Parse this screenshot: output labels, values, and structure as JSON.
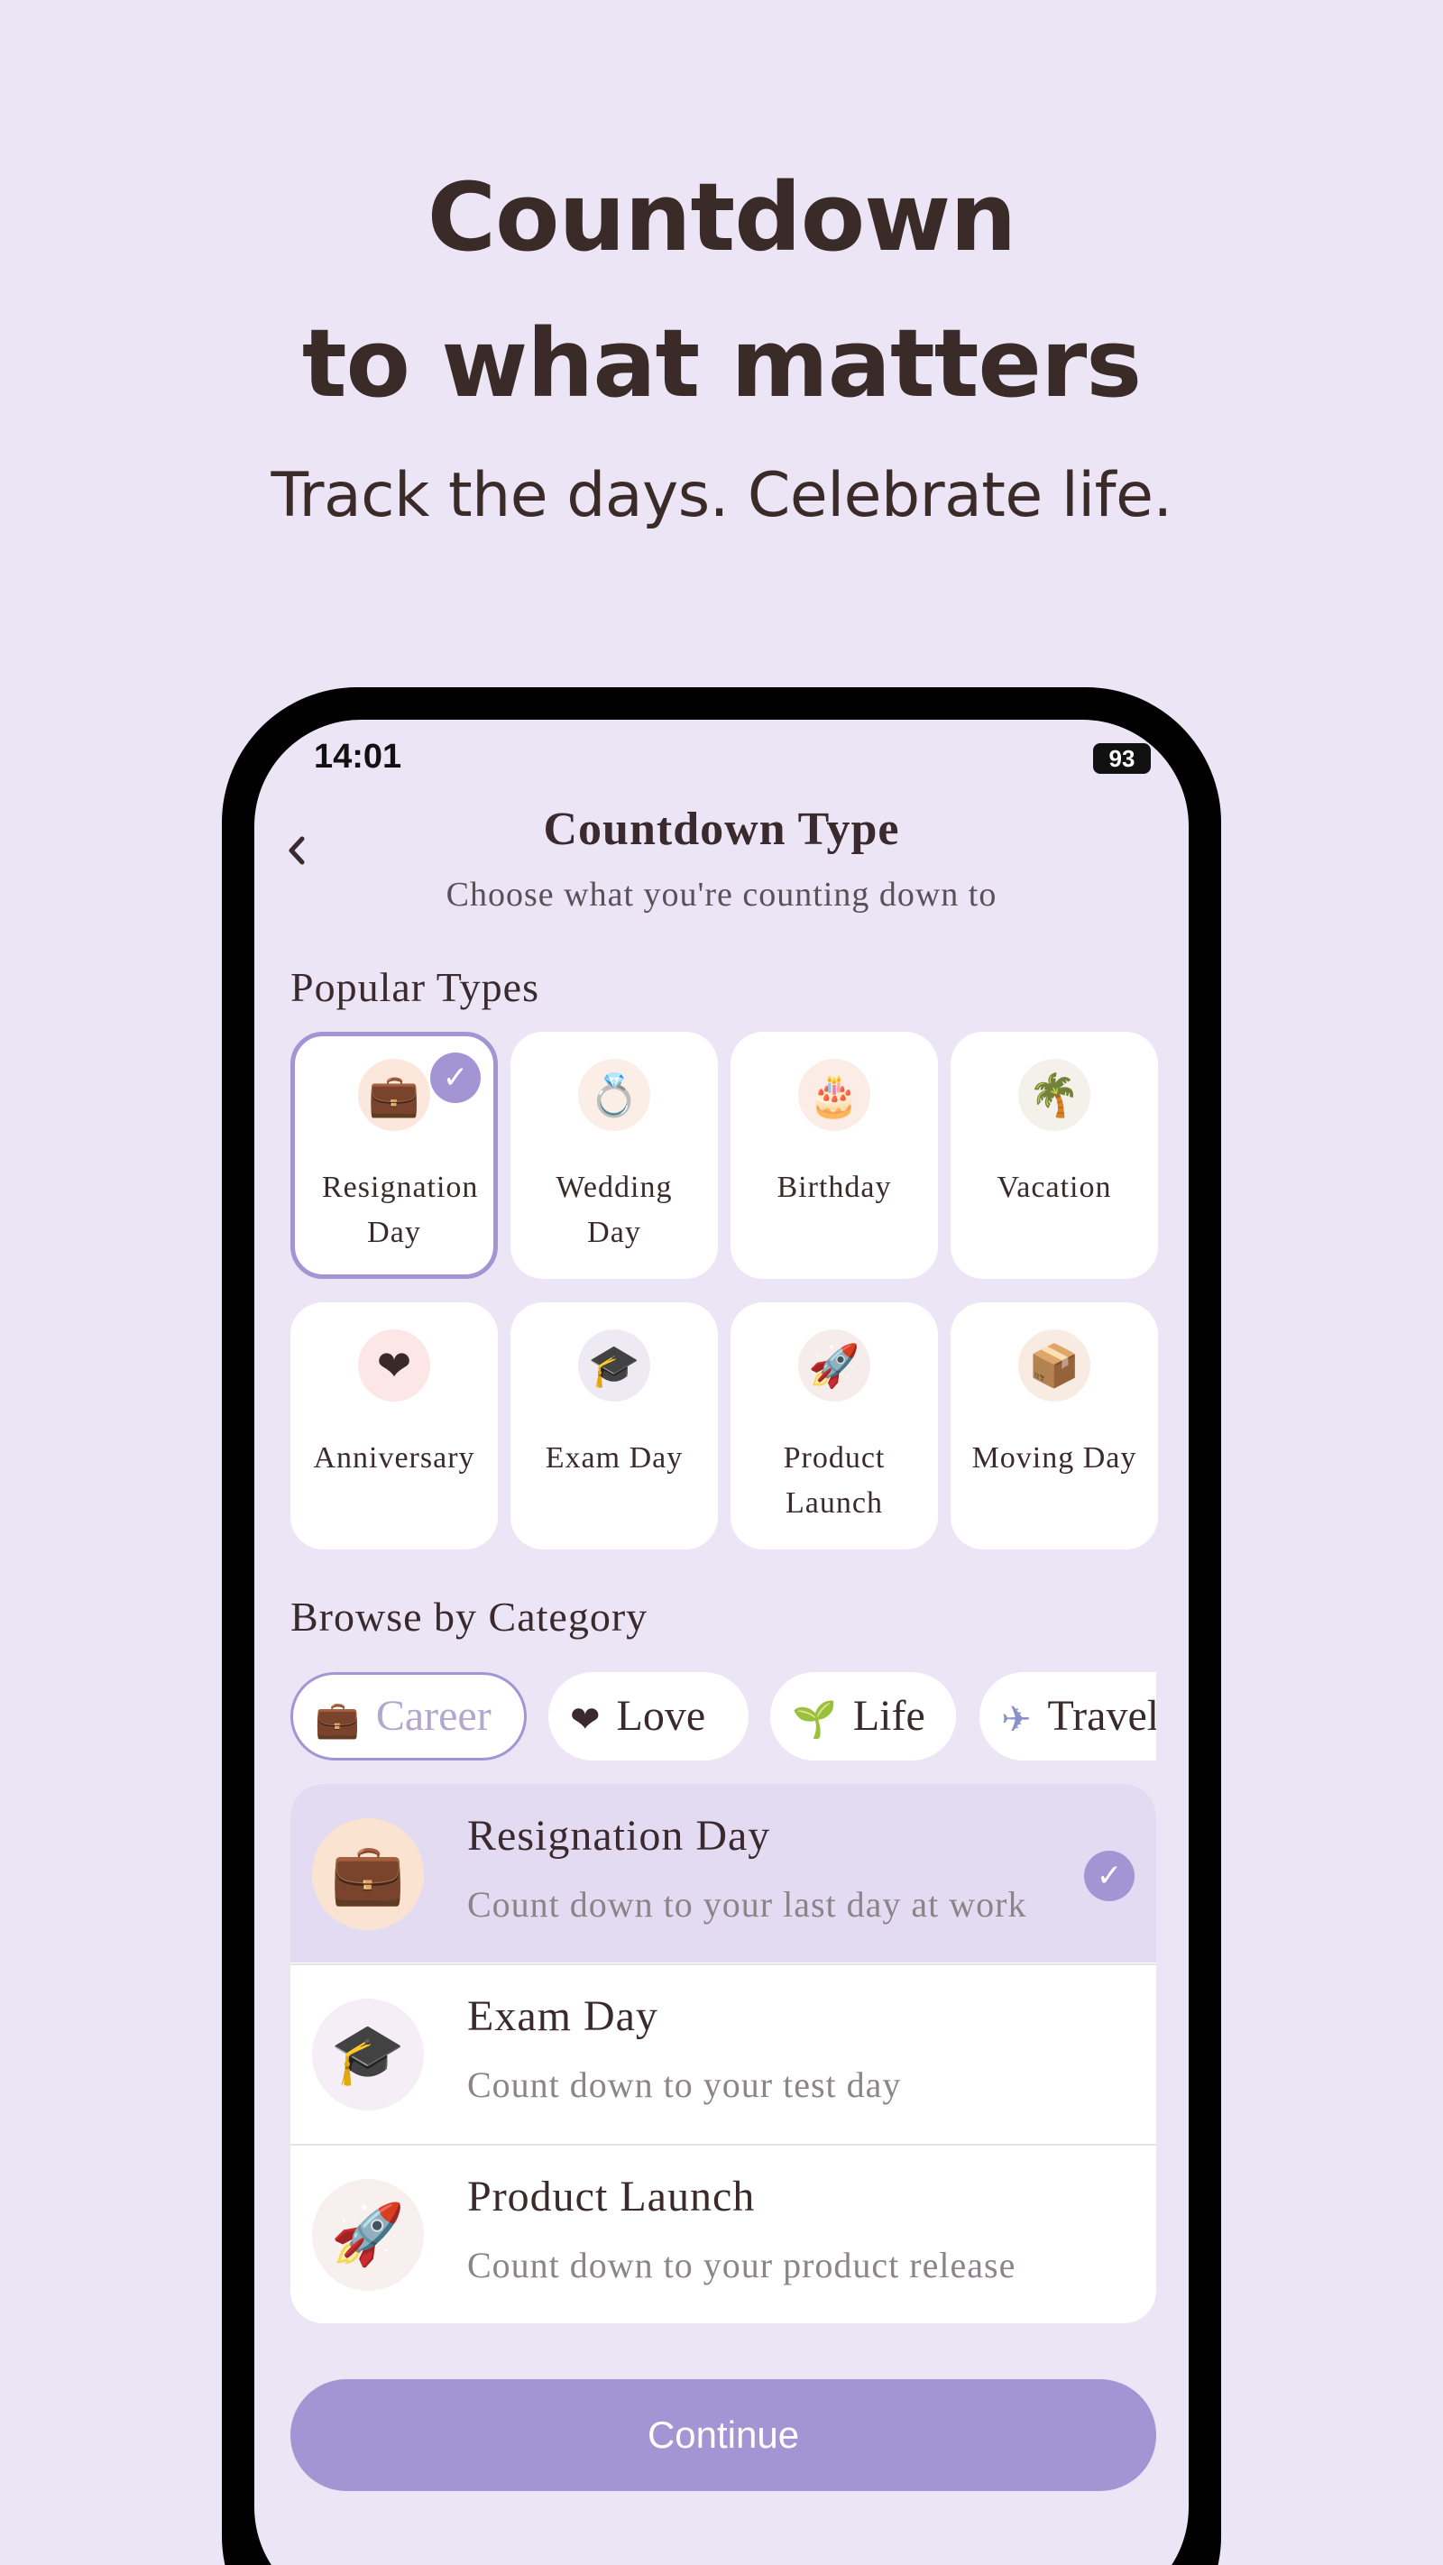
{
  "hero": {
    "title_line1": "Countdown",
    "title_line2": "to what matters",
    "subtitle": "Track the days. Celebrate life."
  },
  "status_bar": {
    "time": "14:01",
    "battery": "93"
  },
  "header": {
    "title": "Countdown Type",
    "subtitle": "Choose what you're counting down to",
    "back_icon": "chevron-left-icon"
  },
  "popular": {
    "label": "Popular Types",
    "items": [
      {
        "label": "Resignation Day",
        "icon": "briefcase-icon",
        "glyph": "💼",
        "selected": true
      },
      {
        "label": "Wedding Day",
        "icon": "rings-icon",
        "glyph": "💍",
        "selected": false
      },
      {
        "label": "Birthday",
        "icon": "cake-icon",
        "glyph": "🎂",
        "selected": false
      },
      {
        "label": "Vacation",
        "icon": "palm-island-icon",
        "glyph": "🌴",
        "selected": false
      },
      {
        "label": "Anniversary",
        "icon": "heart-icon",
        "glyph": "❤",
        "selected": false
      },
      {
        "label": "Exam Day",
        "icon": "graduation-cap-icon",
        "glyph": "🎓",
        "selected": false
      },
      {
        "label": "Product Launch",
        "icon": "rocket-icon",
        "glyph": "🚀",
        "selected": false
      },
      {
        "label": "Moving Day",
        "icon": "box-icon",
        "glyph": "📦",
        "selected": false
      }
    ]
  },
  "category": {
    "label": "Browse by Category",
    "chips": [
      {
        "label": "Career",
        "icon": "briefcase-icon",
        "glyph": "💼",
        "active": true
      },
      {
        "label": "Love",
        "icon": "heart-icon",
        "glyph": "❤",
        "active": false
      },
      {
        "label": "Life",
        "icon": "sprout-icon",
        "glyph": "🌱",
        "active": false
      },
      {
        "label": "Travel",
        "icon": "airplane-icon",
        "glyph": "✈",
        "active": false
      }
    ],
    "list": [
      {
        "title": "Resignation Day",
        "desc": "Count down to your last day at work",
        "icon": "briefcase-icon",
        "glyph": "💼",
        "selected": true
      },
      {
        "title": "Exam Day",
        "desc": "Count down to your test day",
        "icon": "graduation-cap-icon",
        "glyph": "🎓",
        "selected": false
      },
      {
        "title": "Product Launch",
        "desc": "Count down to your product release",
        "icon": "rocket-icon",
        "glyph": "🚀",
        "selected": false
      }
    ]
  },
  "actions": {
    "continue": "Continue"
  },
  "colors": {
    "background": "#ebe5f5",
    "accent": "#a395d3",
    "card": "#ffffff",
    "text_dark": "#3b2b28",
    "text_muted": "#8d8489"
  }
}
